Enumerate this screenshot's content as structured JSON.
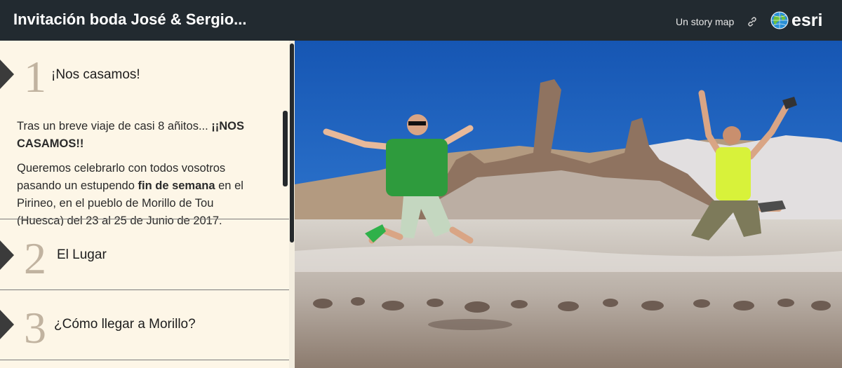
{
  "header": {
    "title": "Invitación boda José & Sergio...",
    "subtitle": "Un story map",
    "logo_text": "esri",
    "share_icon": "link-icon"
  },
  "sections": [
    {
      "number": "1",
      "title": "¡Nos casamos!"
    },
    {
      "number": "2",
      "title": "El Lugar"
    },
    {
      "number": "3",
      "title": "¿Cómo llegar a Morillo?"
    }
  ],
  "content": {
    "p1_a": "Tras un breve viaje de casi 8 añitos... ",
    "p1_b": "¡¡NOS CASAMOS!!",
    "p2_a": "Queremos celebrarlo con todos vosotros pasando un estupendo ",
    "p2_b": "fin de semana",
    "p2_c": " en el Pirineo, en el pueblo de Morillo de Tou (Huesca) del 23 al 25 de Junio de 2017."
  },
  "colors": {
    "topbar": "#222a30",
    "sidebar_bg": "#fdf6e7",
    "number": "#c1b3a0",
    "sky": "#1f64b9"
  }
}
